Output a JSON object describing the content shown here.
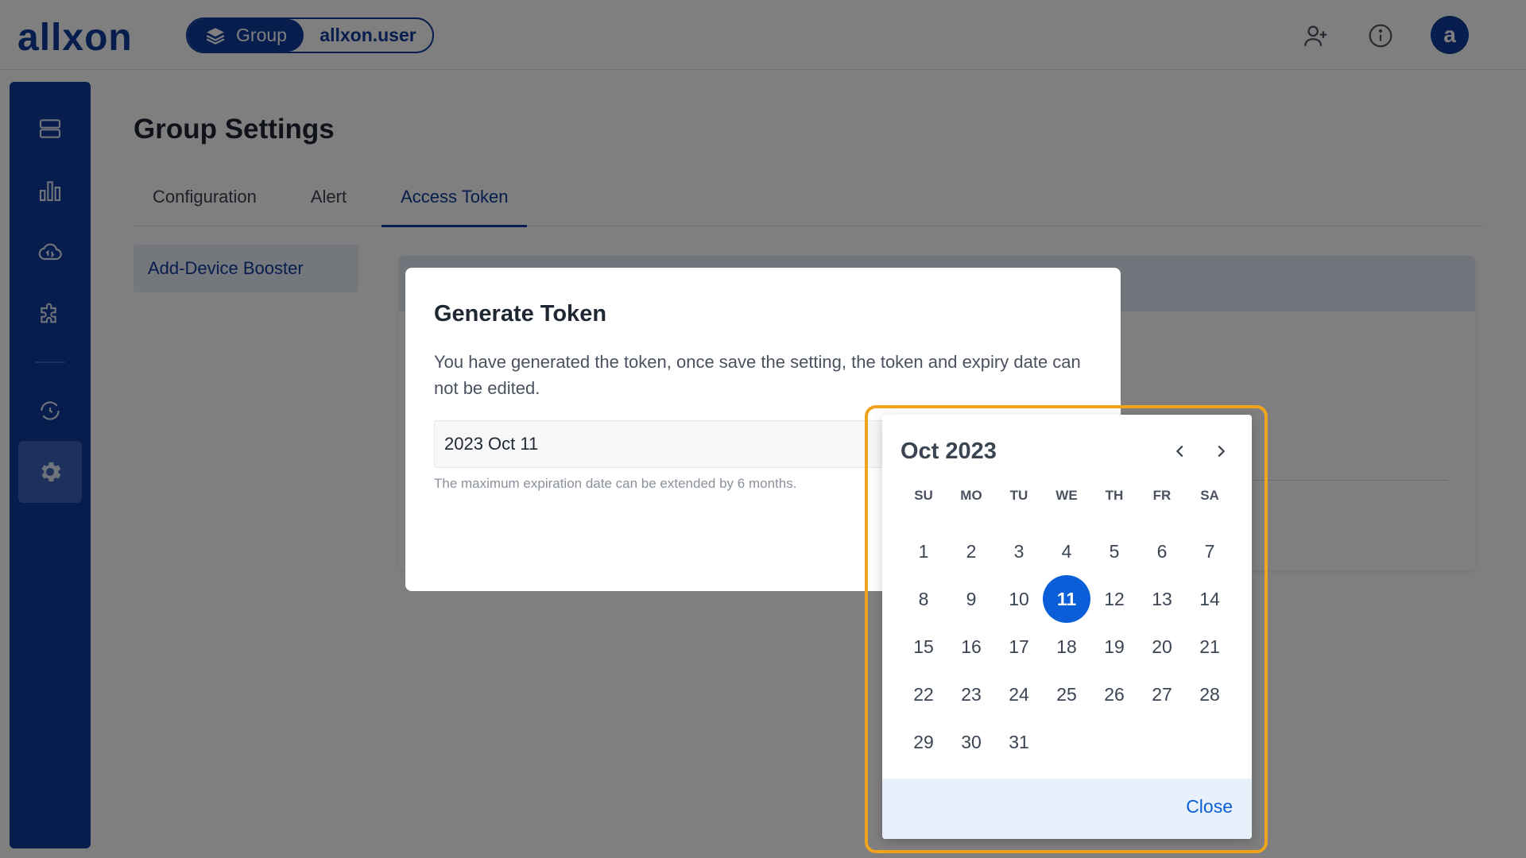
{
  "header": {
    "logo": "allxon",
    "scope_label": "Group",
    "username": "allxon.user",
    "avatar_letter": "a"
  },
  "page": {
    "title": "Group Settings",
    "tabs": [
      {
        "label": "Configuration"
      },
      {
        "label": "Alert"
      },
      {
        "label": "Access Token"
      }
    ],
    "sub_nav": "Add-Device Booster"
  },
  "modal": {
    "title": "Generate Token",
    "description": "You have generated the token, once save the setting, the token and expiry date can not be edited.",
    "date_value": "2023 Oct 11",
    "hint": "The maximum expiration date can be extended by 6 months."
  },
  "calendar": {
    "month_label": "Oct 2023",
    "weekdays": [
      "SU",
      "MO",
      "TU",
      "WE",
      "TH",
      "FR",
      "SA"
    ],
    "selected_day": "11",
    "close_label": "Close"
  },
  "colors": {
    "brand": "#0d3a9c",
    "selected": "#0a5fd8",
    "highlight": "#f0a31f"
  }
}
